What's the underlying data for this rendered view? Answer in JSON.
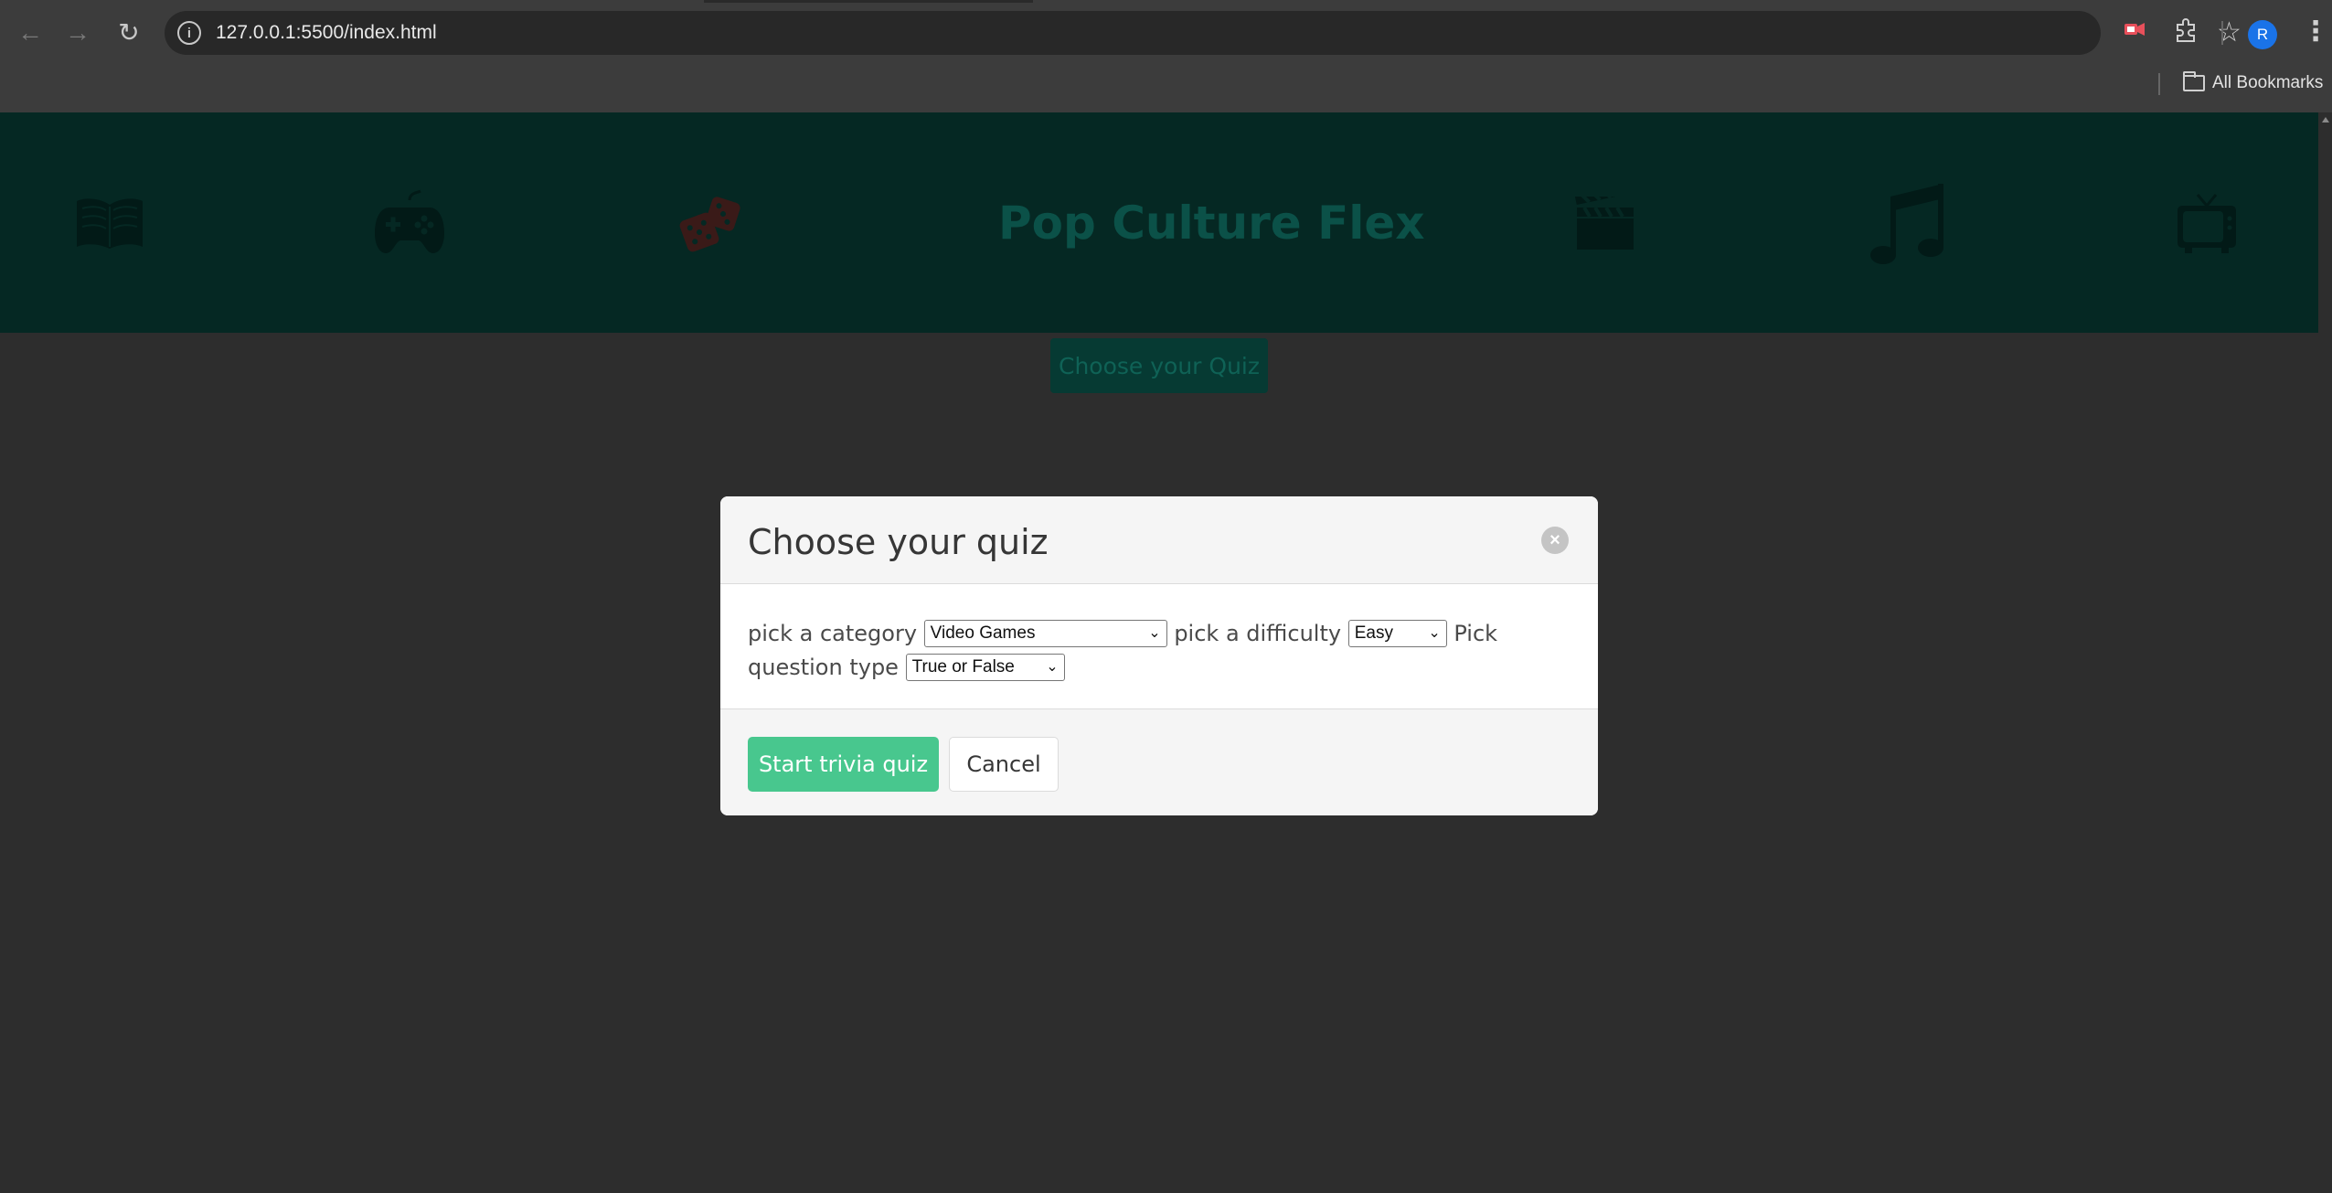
{
  "browser": {
    "url": "127.0.0.1:5500/index.html",
    "profile_initial": "R",
    "bookmarks_label": "All Bookmarks"
  },
  "banner": {
    "title": "Pop Culture Flex",
    "icons": [
      "book-icon",
      "gamepad-icon",
      "dice-icon",
      "clapperboard-icon",
      "music-note-icon",
      "tv-icon"
    ]
  },
  "open_button_label": "Choose your Quiz",
  "modal": {
    "title": "Choose your quiz",
    "category_label": "pick a category",
    "category_value": "Video Games",
    "difficulty_label": "pick a difficulty",
    "difficulty_value": "Easy",
    "type_label_1": "Pick question",
    "type_label_2": "type",
    "type_value": "True or False",
    "start_label": "Start trivia quiz",
    "cancel_label": "Cancel"
  },
  "colors": {
    "banner_bg": "#052823",
    "primary_button": "#48c78e",
    "page_bg": "#2d2d2d"
  }
}
